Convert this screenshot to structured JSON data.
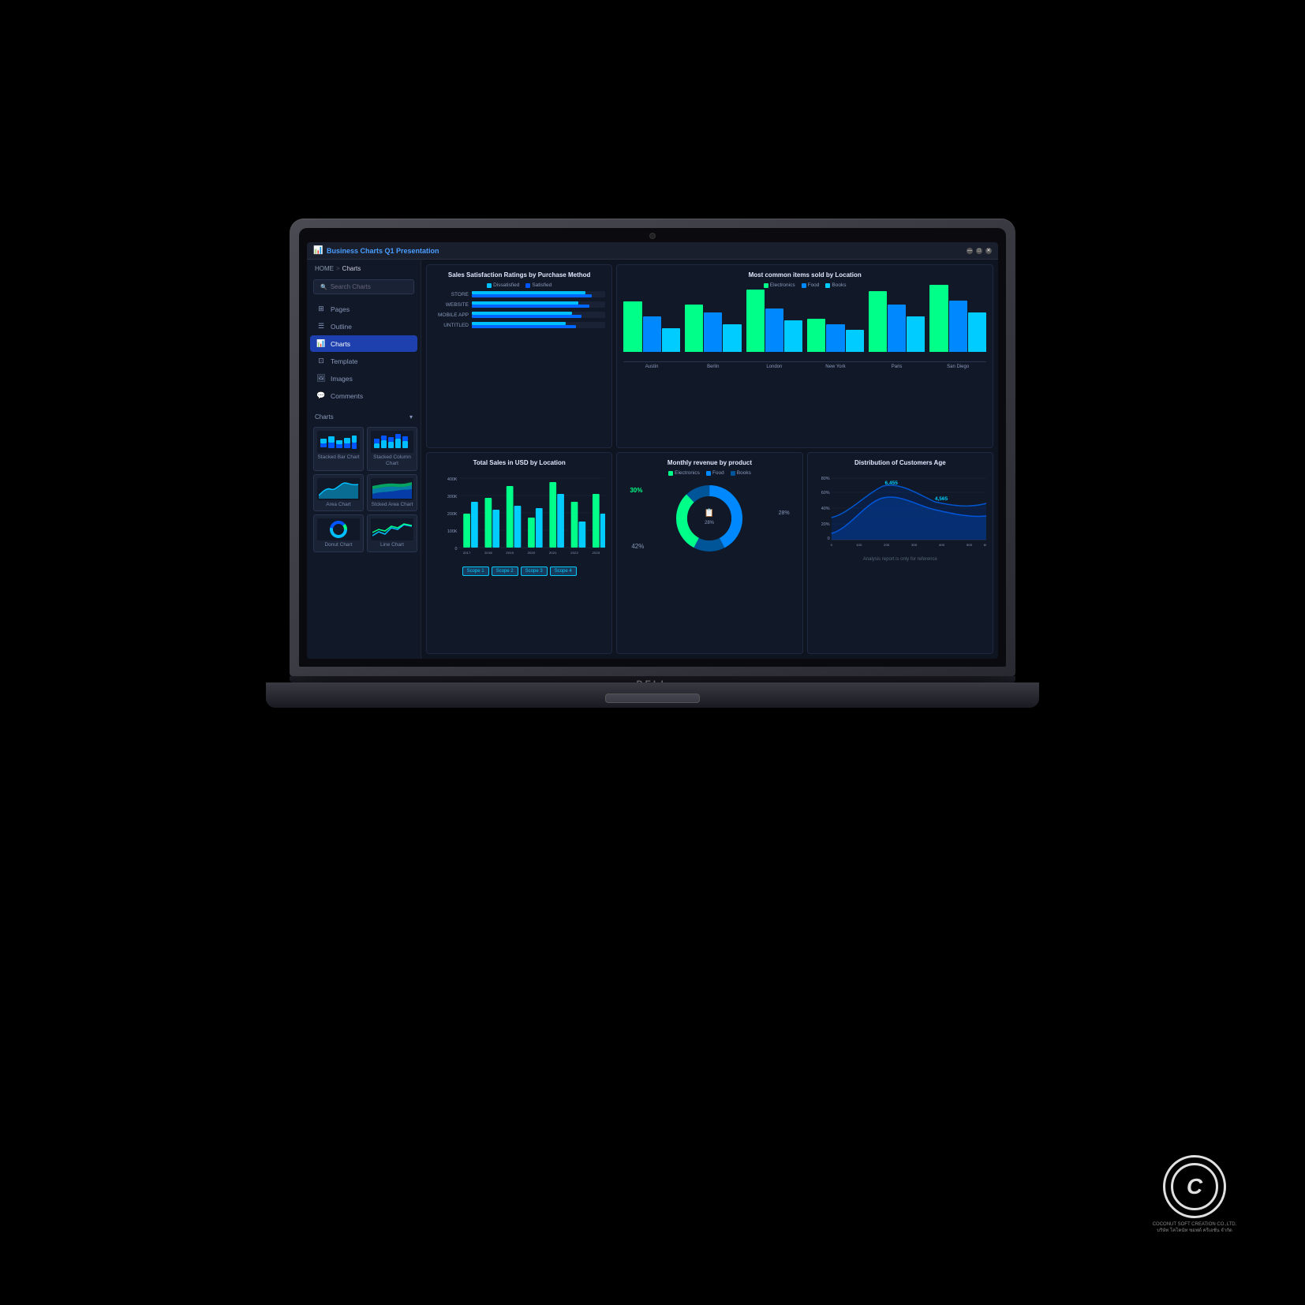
{
  "window": {
    "title": "Business Charts Q1 Presentation",
    "minimize": "—",
    "maximize": "□",
    "close": "✕"
  },
  "breadcrumb": {
    "home": "HOME",
    "separator": ">",
    "current": "Charts"
  },
  "search": {
    "placeholder": "Search Charts"
  },
  "nav": {
    "items": [
      {
        "id": "pages",
        "label": "Pages",
        "icon": "⊞"
      },
      {
        "id": "outline",
        "label": "Outline",
        "icon": "☰"
      },
      {
        "id": "charts",
        "label": "Charts",
        "icon": "📊",
        "active": true
      },
      {
        "id": "template",
        "label": "Template",
        "icon": "⊡"
      },
      {
        "id": "images",
        "label": "Images",
        "icon": "🖼"
      },
      {
        "id": "comments",
        "label": "Comments",
        "icon": "💬"
      }
    ]
  },
  "charts_section": {
    "label": "Charts",
    "thumbnails": [
      {
        "label": "Stacked Bar Chart",
        "type": "bar"
      },
      {
        "label": "Stacked Column Chart",
        "type": "column"
      },
      {
        "label": "Area Chart",
        "type": "area"
      },
      {
        "label": "Stcked Area Chart",
        "type": "stacked-area"
      },
      {
        "label": "Donut Chart",
        "type": "donut"
      },
      {
        "label": "Line Chart",
        "type": "line"
      }
    ]
  },
  "panels": {
    "sales_satisfaction": {
      "title": "Sales Satisfaction Ratings by Purchase Method",
      "legend": [
        {
          "label": "Dissatisfied",
          "color": "#00bfff"
        },
        {
          "label": "Satisfied",
          "color": "#0055ff"
        }
      ],
      "bars": [
        {
          "label": "STORE",
          "dis": 85,
          "sat": 90
        },
        {
          "label": "WEBSITE",
          "dis": 80,
          "sat": 88
        },
        {
          "label": "MOBILE APP",
          "dis": 75,
          "sat": 82
        },
        {
          "label": "UNTITLED",
          "dis": 70,
          "sat": 78
        }
      ]
    },
    "common_items": {
      "title": "Most common items sold by Location",
      "legend": [
        {
          "label": "Electronics",
          "color": "#00ff88"
        },
        {
          "label": "Food",
          "color": "#0088ff"
        },
        {
          "label": "Books",
          "color": "#00ccff"
        }
      ],
      "locations": [
        "Austin",
        "Berlin",
        "London",
        "New York",
        "Paris",
        "San Diego"
      ],
      "percentages": [
        "64%",
        "60%",
        "79%",
        "42%",
        "77%",
        "95%"
      ]
    },
    "total_sales": {
      "title": "Total Sales in USD by Location",
      "yAxis": [
        "400,000",
        "300,000",
        "200,000",
        "100,000",
        "0"
      ],
      "scopes": [
        "Scope 1",
        "Scope 2",
        "Scope 3",
        "Scope 4"
      ]
    },
    "monthly_revenue": {
      "title": "Monthly revenue by product",
      "legend": [
        {
          "label": "Electronics",
          "color": "#00ff88"
        },
        {
          "label": "Food",
          "color": "#0088ff"
        },
        {
          "label": "Books",
          "color": "#005599"
        }
      ],
      "center_pct": "28%",
      "label_30": "30%",
      "label_42": "42%"
    },
    "distribution": {
      "title": "Distribution of Customers Age",
      "yAxis": [
        "80%",
        "60%",
        "40%",
        "20%",
        "0"
      ],
      "xAxis": [
        "0",
        "100",
        "200",
        "300",
        "400",
        "500",
        "600"
      ],
      "value1": "6,455",
      "value2": "4,565",
      "note": "Analysis report is only for reference"
    }
  }
}
